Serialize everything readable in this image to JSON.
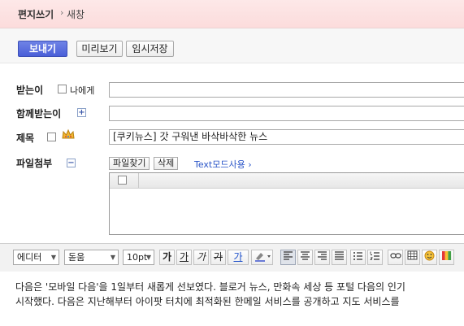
{
  "header": {
    "title": "편지쓰기",
    "separator": "›",
    "subtitle": "새창"
  },
  "toolbar": {
    "send": "보내기",
    "preview": "미리보기",
    "save_draft": "임시저장"
  },
  "form": {
    "to_label": "받는이",
    "to_self": "나에게",
    "to_value": "",
    "cc_label": "함께받는이",
    "cc_value": "",
    "subject_label": "제목",
    "subject_value": "[쿠키뉴스] 갓 구워낸 바삭바삭한 뉴스",
    "attach_label": "파일첨부",
    "find_file": "파일찾기",
    "delete": "삭제",
    "text_mode": "Text모드사용 ›"
  },
  "editor_toolbar": {
    "mode": "에디터",
    "font": "돋움",
    "size": "10pt",
    "bold": "가",
    "underline": "가",
    "italic": "가",
    "strike": "가",
    "color": "가"
  },
  "body": {
    "line1": "다음은 '모바일 다음'을 1일부터 새롭게 선보였다. 블로거 뉴스, 만화속 세상 등 포털 다음의 인기",
    "line2": "시작했다. 다음은 지난해부터 아이팟 터치에 최적화된 한메일 서비스를 공개하고 지도 서비스를"
  }
}
